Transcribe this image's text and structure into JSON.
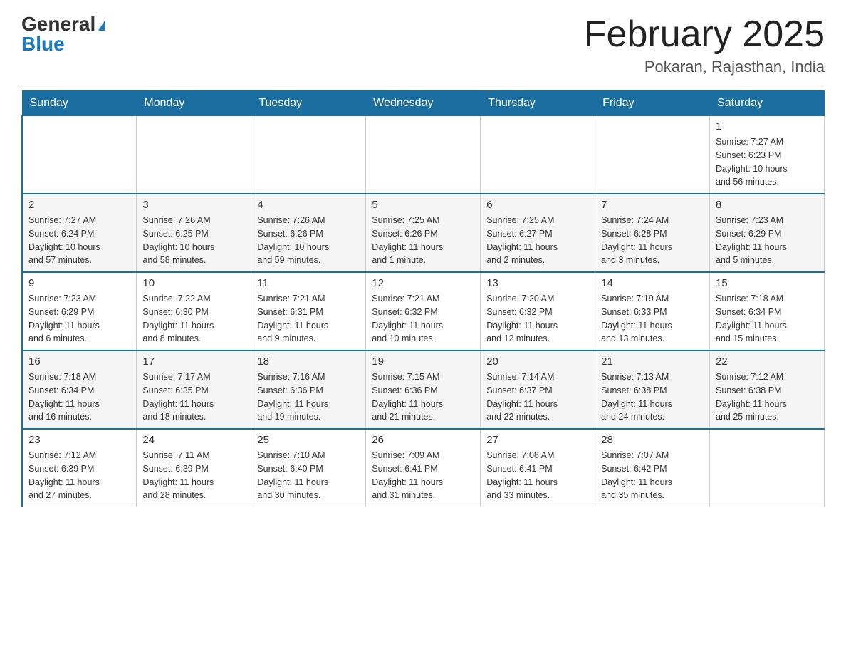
{
  "logo": {
    "general": "General",
    "blue": "Blue"
  },
  "title": "February 2025",
  "location": "Pokaran, Rajasthan, India",
  "days_of_week": [
    "Sunday",
    "Monday",
    "Tuesday",
    "Wednesday",
    "Thursday",
    "Friday",
    "Saturday"
  ],
  "weeks": [
    [
      {
        "day": "",
        "info": ""
      },
      {
        "day": "",
        "info": ""
      },
      {
        "day": "",
        "info": ""
      },
      {
        "day": "",
        "info": ""
      },
      {
        "day": "",
        "info": ""
      },
      {
        "day": "",
        "info": ""
      },
      {
        "day": "1",
        "info": "Sunrise: 7:27 AM\nSunset: 6:23 PM\nDaylight: 10 hours\nand 56 minutes."
      }
    ],
    [
      {
        "day": "2",
        "info": "Sunrise: 7:27 AM\nSunset: 6:24 PM\nDaylight: 10 hours\nand 57 minutes."
      },
      {
        "day": "3",
        "info": "Sunrise: 7:26 AM\nSunset: 6:25 PM\nDaylight: 10 hours\nand 58 minutes."
      },
      {
        "day": "4",
        "info": "Sunrise: 7:26 AM\nSunset: 6:26 PM\nDaylight: 10 hours\nand 59 minutes."
      },
      {
        "day": "5",
        "info": "Sunrise: 7:25 AM\nSunset: 6:26 PM\nDaylight: 11 hours\nand 1 minute."
      },
      {
        "day": "6",
        "info": "Sunrise: 7:25 AM\nSunset: 6:27 PM\nDaylight: 11 hours\nand 2 minutes."
      },
      {
        "day": "7",
        "info": "Sunrise: 7:24 AM\nSunset: 6:28 PM\nDaylight: 11 hours\nand 3 minutes."
      },
      {
        "day": "8",
        "info": "Sunrise: 7:23 AM\nSunset: 6:29 PM\nDaylight: 11 hours\nand 5 minutes."
      }
    ],
    [
      {
        "day": "9",
        "info": "Sunrise: 7:23 AM\nSunset: 6:29 PM\nDaylight: 11 hours\nand 6 minutes."
      },
      {
        "day": "10",
        "info": "Sunrise: 7:22 AM\nSunset: 6:30 PM\nDaylight: 11 hours\nand 8 minutes."
      },
      {
        "day": "11",
        "info": "Sunrise: 7:21 AM\nSunset: 6:31 PM\nDaylight: 11 hours\nand 9 minutes."
      },
      {
        "day": "12",
        "info": "Sunrise: 7:21 AM\nSunset: 6:32 PM\nDaylight: 11 hours\nand 10 minutes."
      },
      {
        "day": "13",
        "info": "Sunrise: 7:20 AM\nSunset: 6:32 PM\nDaylight: 11 hours\nand 12 minutes."
      },
      {
        "day": "14",
        "info": "Sunrise: 7:19 AM\nSunset: 6:33 PM\nDaylight: 11 hours\nand 13 minutes."
      },
      {
        "day": "15",
        "info": "Sunrise: 7:18 AM\nSunset: 6:34 PM\nDaylight: 11 hours\nand 15 minutes."
      }
    ],
    [
      {
        "day": "16",
        "info": "Sunrise: 7:18 AM\nSunset: 6:34 PM\nDaylight: 11 hours\nand 16 minutes."
      },
      {
        "day": "17",
        "info": "Sunrise: 7:17 AM\nSunset: 6:35 PM\nDaylight: 11 hours\nand 18 minutes."
      },
      {
        "day": "18",
        "info": "Sunrise: 7:16 AM\nSunset: 6:36 PM\nDaylight: 11 hours\nand 19 minutes."
      },
      {
        "day": "19",
        "info": "Sunrise: 7:15 AM\nSunset: 6:36 PM\nDaylight: 11 hours\nand 21 minutes."
      },
      {
        "day": "20",
        "info": "Sunrise: 7:14 AM\nSunset: 6:37 PM\nDaylight: 11 hours\nand 22 minutes."
      },
      {
        "day": "21",
        "info": "Sunrise: 7:13 AM\nSunset: 6:38 PM\nDaylight: 11 hours\nand 24 minutes."
      },
      {
        "day": "22",
        "info": "Sunrise: 7:12 AM\nSunset: 6:38 PM\nDaylight: 11 hours\nand 25 minutes."
      }
    ],
    [
      {
        "day": "23",
        "info": "Sunrise: 7:12 AM\nSunset: 6:39 PM\nDaylight: 11 hours\nand 27 minutes."
      },
      {
        "day": "24",
        "info": "Sunrise: 7:11 AM\nSunset: 6:39 PM\nDaylight: 11 hours\nand 28 minutes."
      },
      {
        "day": "25",
        "info": "Sunrise: 7:10 AM\nSunset: 6:40 PM\nDaylight: 11 hours\nand 30 minutes."
      },
      {
        "day": "26",
        "info": "Sunrise: 7:09 AM\nSunset: 6:41 PM\nDaylight: 11 hours\nand 31 minutes."
      },
      {
        "day": "27",
        "info": "Sunrise: 7:08 AM\nSunset: 6:41 PM\nDaylight: 11 hours\nand 33 minutes."
      },
      {
        "day": "28",
        "info": "Sunrise: 7:07 AM\nSunset: 6:42 PM\nDaylight: 11 hours\nand 35 minutes."
      },
      {
        "day": "",
        "info": ""
      }
    ]
  ]
}
